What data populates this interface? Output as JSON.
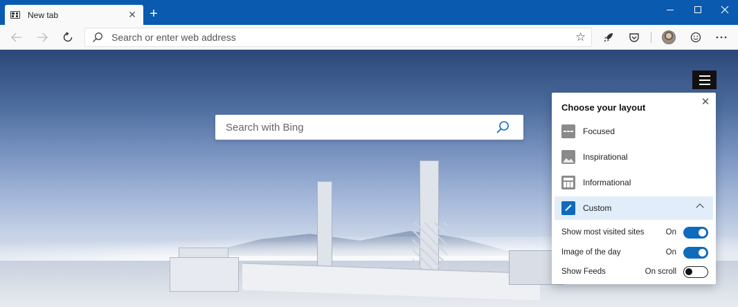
{
  "tab": {
    "title": "New tab"
  },
  "window_controls": [
    "minimize",
    "maximize",
    "close"
  ],
  "toolbar": {
    "address_placeholder": "Search or enter web address",
    "icons": [
      "back-icon",
      "forward-icon",
      "refresh-icon",
      "favorite-star-icon",
      "rocket-icon",
      "pocket-icon",
      "profile-avatar",
      "emoji-icon",
      "more-icon"
    ]
  },
  "newtab": {
    "search_placeholder": "Search with Bing"
  },
  "layout_panel": {
    "title": "Choose your layout",
    "options": [
      {
        "label": "Focused",
        "icon": "focused-layout-icon"
      },
      {
        "label": "Inspirational",
        "icon": "inspirational-layout-icon"
      },
      {
        "label": "Informational",
        "icon": "informational-layout-icon"
      },
      {
        "label": "Custom",
        "icon": "custom-layout-icon",
        "selected": true
      }
    ],
    "settings": [
      {
        "label": "Show most visited sites",
        "state": "On",
        "enabled": true
      },
      {
        "label": "Image of the day",
        "state": "On",
        "enabled": true
      },
      {
        "label": "Show Feeds",
        "state": "On scroll",
        "enabled": false
      }
    ]
  },
  "colors": {
    "titlebar": "#0a5ab0",
    "accent": "#0f6cbd",
    "selected_bg": "#e1eefa"
  }
}
